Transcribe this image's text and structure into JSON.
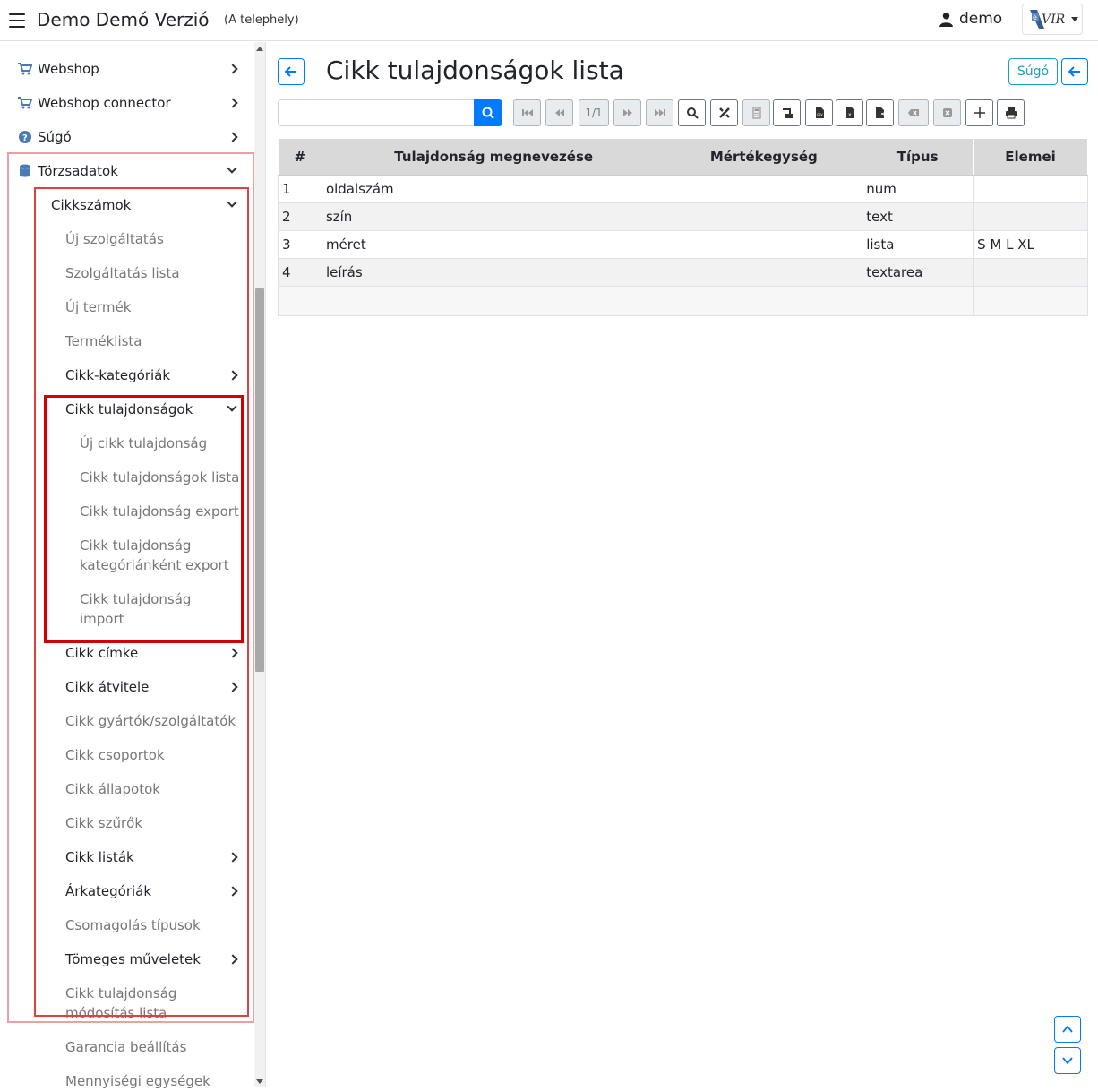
{
  "header": {
    "title": "Demo Demó Verzió",
    "subtitle": "(A telephely)",
    "user": "demo",
    "logo_text": "eVIR"
  },
  "sidebar": {
    "items": [
      {
        "label": "Webshop"
      },
      {
        "label": "Webshop connector"
      },
      {
        "label": "Súgó"
      },
      {
        "label": "Törzsadatok"
      },
      {
        "label": "Cikkszámok"
      },
      {
        "label": "Új szolgáltatás"
      },
      {
        "label": "Szolgáltatás lista"
      },
      {
        "label": "Új termék"
      },
      {
        "label": "Terméklista"
      },
      {
        "label": "Cikk-kategóriák"
      },
      {
        "label": "Cikk tulajdonságok"
      },
      {
        "label": "Új cikk tulajdonság"
      },
      {
        "label": "Cikk tulajdonságok lista"
      },
      {
        "label": "Cikk tulajdonság export"
      },
      {
        "label": "Cikk tulajdonság kategóriánként export"
      },
      {
        "label": "Cikk tulajdonság import"
      },
      {
        "label": "Cikk címke"
      },
      {
        "label": "Cikk átvitele"
      },
      {
        "label": "Cikk gyártók/szolgáltatók"
      },
      {
        "label": "Cikk csoportok"
      },
      {
        "label": "Cikk állapotok"
      },
      {
        "label": "Cikk szűrők"
      },
      {
        "label": "Cikk listák"
      },
      {
        "label": "Árkategóriák"
      },
      {
        "label": "Csomagolás típusok"
      },
      {
        "label": "Tömeges műveletek"
      },
      {
        "label": "Cikk tulajdonság módosítás lista"
      },
      {
        "label": "Garancia beállítás"
      },
      {
        "label": "Mennyiségi egységek"
      }
    ]
  },
  "main": {
    "title": "Cikk tulajdonságok lista",
    "help_label": "Súgó",
    "search": {
      "value": "",
      "placeholder": ""
    },
    "pager_label": "1/1",
    "table": {
      "headers": [
        "#",
        "Tulajdonság megnevezése",
        "Mértékegység",
        "Típus",
        "Elemei"
      ],
      "rows": [
        [
          "1",
          "oldalszám",
          "",
          "num",
          ""
        ],
        [
          "2",
          "szín",
          "",
          "text",
          ""
        ],
        [
          "3",
          "méret",
          "",
          "lista",
          "S M L XL"
        ],
        [
          "4",
          "leírás",
          "",
          "textarea",
          ""
        ]
      ]
    }
  },
  "colors": {
    "accent": "#007bff",
    "highlight": "#e04040",
    "help": "#17a2b8"
  }
}
